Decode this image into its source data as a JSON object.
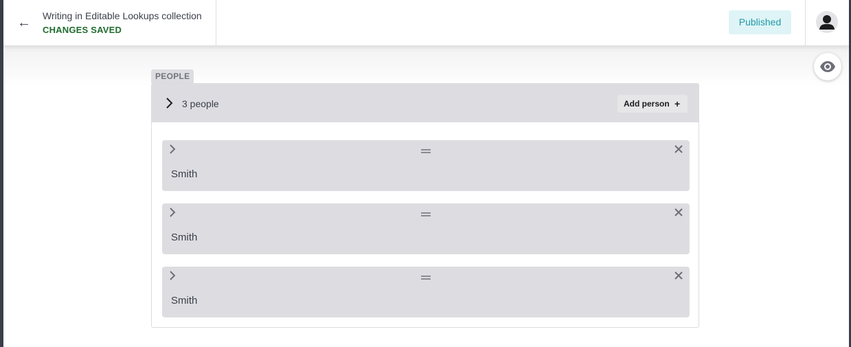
{
  "topbar": {
    "back_icon": "←",
    "title": "Writing in Editable Lookups collection",
    "save_status": "CHANGES SAVED",
    "status_badge": "Published"
  },
  "field": {
    "label": "PEOPLE",
    "count_label": "3 people",
    "add_button_label": "Add person",
    "add_icon": "+",
    "items": [
      {
        "name": "Smith"
      },
      {
        "name": "Smith"
      },
      {
        "name": "Smith"
      }
    ]
  },
  "icons": {
    "back": "arrow-left-icon",
    "avatar": "user-icon",
    "preview": "eye-icon",
    "expand": "chevron-right-icon",
    "drag": "drag-handle-icon",
    "remove": "close-icon",
    "add": "plus-icon"
  },
  "colors": {
    "save_status": "#1f6b2e",
    "badge_bg": "#dff4f6",
    "badge_text": "#1f9aa8",
    "panel_bg": "#dddde1"
  }
}
